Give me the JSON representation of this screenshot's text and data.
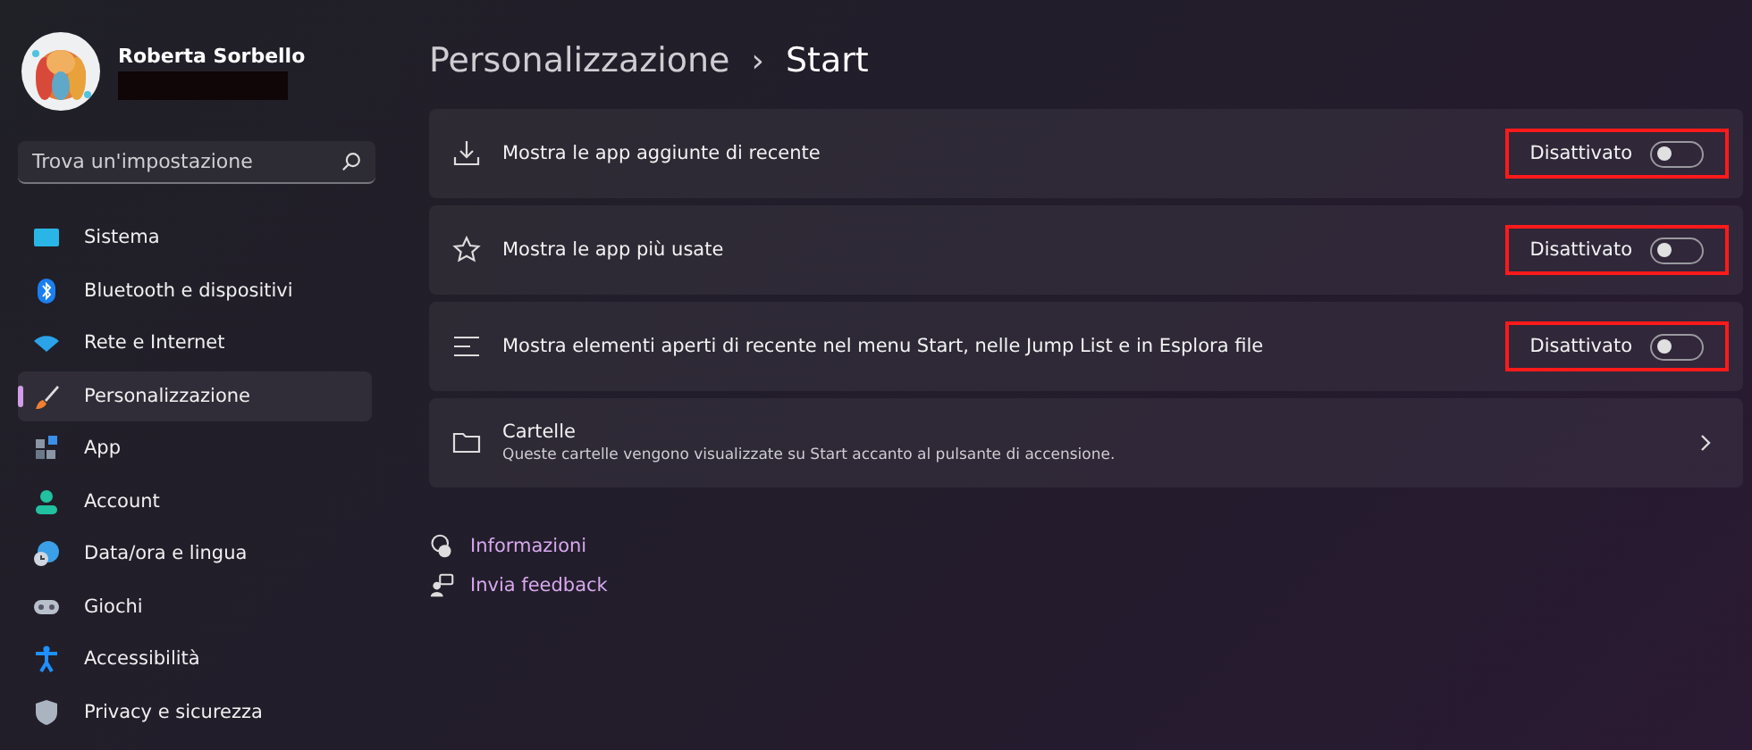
{
  "user": {
    "name": "Roberta Sorbello"
  },
  "search": {
    "placeholder": "Trova un'impostazione"
  },
  "sidebar": {
    "items": [
      {
        "label": "Sistema",
        "selected": false
      },
      {
        "label": "Bluetooth e dispositivi",
        "selected": false
      },
      {
        "label": "Rete e Internet",
        "selected": false
      },
      {
        "label": "Personalizzazione",
        "selected": true
      },
      {
        "label": "App",
        "selected": false
      },
      {
        "label": "Account",
        "selected": false
      },
      {
        "label": "Data/ora e lingua",
        "selected": false
      },
      {
        "label": "Giochi",
        "selected": false
      },
      {
        "label": "Accessibilità",
        "selected": false
      },
      {
        "label": "Privacy e sicurezza",
        "selected": false
      }
    ]
  },
  "breadcrumb": {
    "parent": "Personalizzazione",
    "separator": "›",
    "current": "Start"
  },
  "settings": [
    {
      "kind": "toggle",
      "label": "Mostra le app aggiunte di recente",
      "state_label": "Disattivato",
      "on": false,
      "highlighted": true
    },
    {
      "kind": "toggle",
      "label": "Mostra le app più usate",
      "state_label": "Disattivato",
      "on": false,
      "highlighted": true
    },
    {
      "kind": "toggle",
      "label": "Mostra elementi aperti di recente nel menu Start, nelle Jump List e in Esplora file",
      "state_label": "Disattivato",
      "on": false,
      "highlighted": true
    },
    {
      "kind": "link",
      "label": "Cartelle",
      "description": "Queste cartelle vengono visualizzate su Start accanto al pulsante di accensione."
    }
  ],
  "help_links": [
    {
      "label": "Informazioni"
    },
    {
      "label": "Invia feedback"
    }
  ]
}
